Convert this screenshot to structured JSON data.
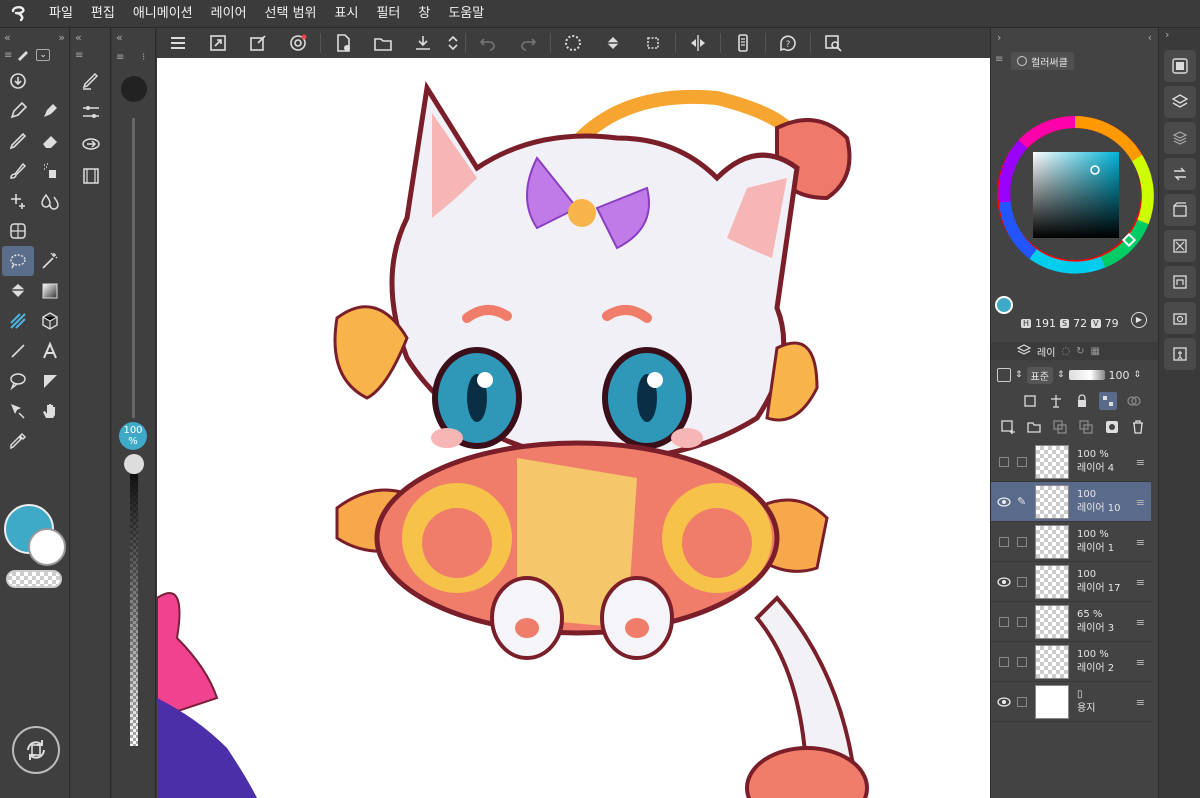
{
  "menu": {
    "items": [
      "파일",
      "편집",
      "애니메이션",
      "레이어",
      "선택 범위",
      "표시",
      "필터",
      "창",
      "도움말"
    ]
  },
  "command_bar": {
    "icons": [
      "menu-icon",
      "expand-icon",
      "canvas-new-icon",
      "settings-swirl-icon",
      "new-file-icon",
      "open-folder-icon",
      "export-icon",
      "spinner-icon",
      "undo-icon",
      "redo-icon",
      "loading-icon",
      "fill-icon",
      "crop-icon",
      "flip-icon",
      "phone-icon",
      "help-icon",
      "zoom-icon"
    ]
  },
  "brush": {
    "opacity_label": "100",
    "opacity_unit": "%"
  },
  "colors": {
    "main": "#3fa9c8",
    "sub": "#ffffff",
    "accent": "#5a6a8a"
  },
  "color_panel": {
    "tab_label": "컬러써클",
    "h_key": "H",
    "h_value": "191",
    "s_key": "S",
    "s_value": "72",
    "v_key": "V",
    "v_value": "79"
  },
  "layer_panel": {
    "tab_label": "레이",
    "blend_mode": "표준",
    "opacity": "100",
    "layers": [
      {
        "opacity": "100 %",
        "name": "레이어 4",
        "visible": false,
        "selected": false
      },
      {
        "opacity": "100",
        "name": "레이어 10",
        "visible": true,
        "selected": true
      },
      {
        "opacity": "100 %",
        "name": "레이어 1",
        "visible": false,
        "selected": false
      },
      {
        "opacity": "100",
        "name": "레이어 17",
        "visible": true,
        "selected": false
      },
      {
        "opacity": "65 %",
        "name": "레이어 3",
        "visible": false,
        "selected": false
      },
      {
        "opacity": "100 %",
        "name": "레이어 2",
        "visible": false,
        "selected": false
      },
      {
        "opacity": "",
        "name": "용지",
        "visible": true,
        "selected": false
      }
    ]
  }
}
